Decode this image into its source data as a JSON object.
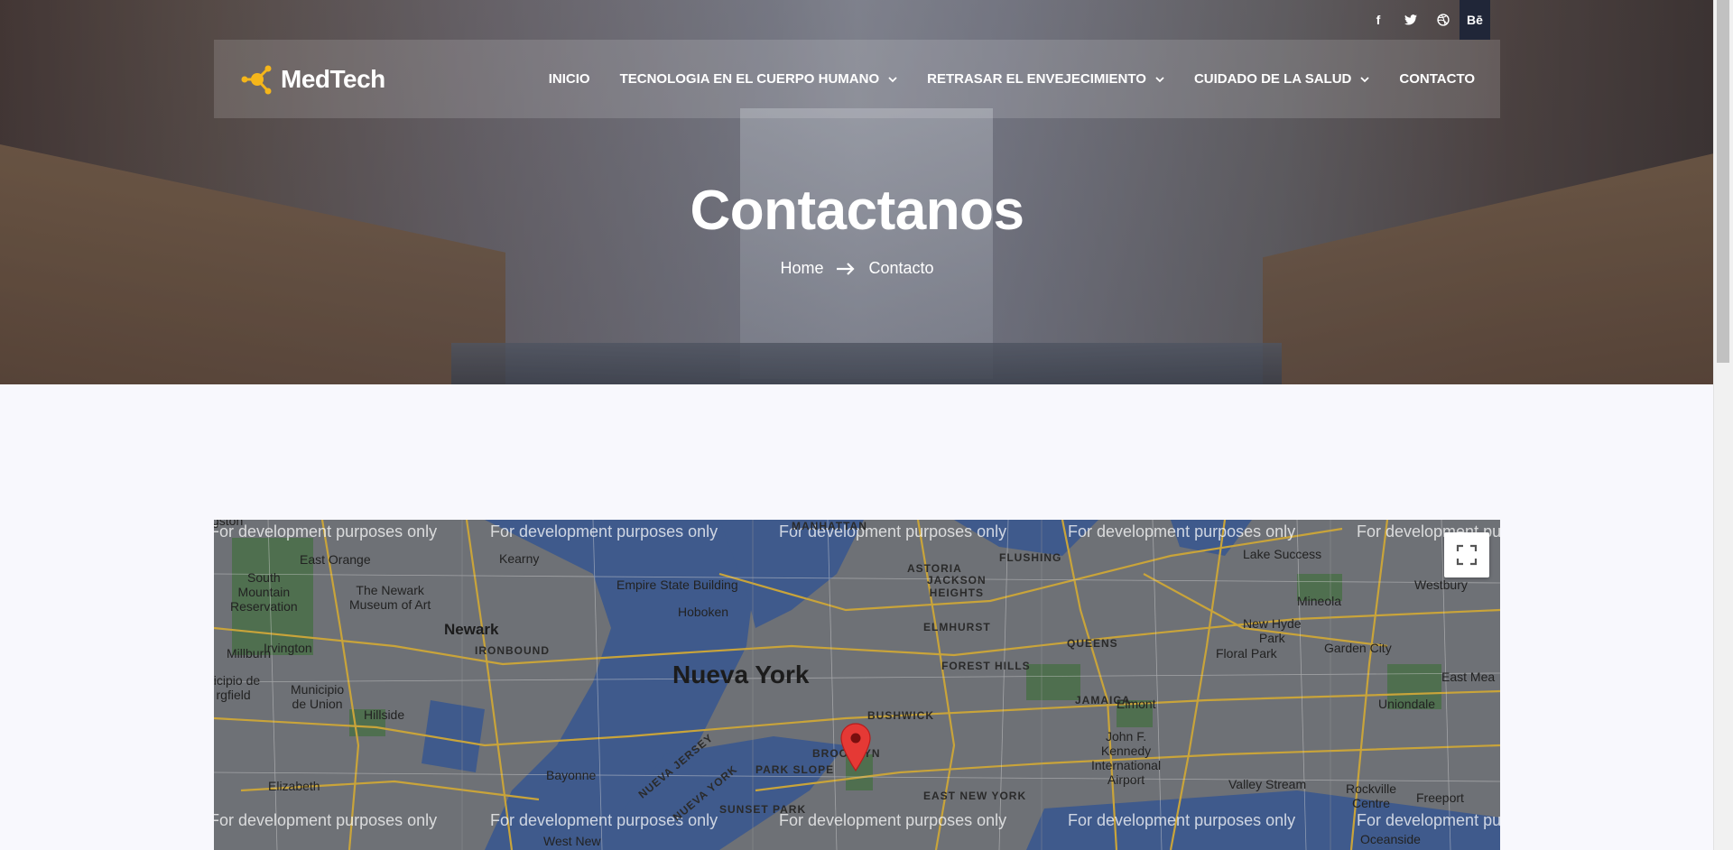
{
  "brand": {
    "name": "MedTech",
    "accent": "#f5b61a"
  },
  "social": [
    {
      "icon": "facebook-icon",
      "glyph": "f"
    },
    {
      "icon": "twitter-icon",
      "glyph": "🐦"
    },
    {
      "icon": "dribbble-icon",
      "glyph": "⊛"
    },
    {
      "icon": "behance-icon",
      "glyph": "Bē"
    }
  ],
  "nav": {
    "items": [
      {
        "label": "INICIO",
        "has_dropdown": false
      },
      {
        "label": "TECNOLOGIA EN EL CUERPO HUMANO",
        "has_dropdown": true
      },
      {
        "label": "RETRASAR EL ENVEJECIMIENTO",
        "has_dropdown": true
      },
      {
        "label": "CUIDADO DE LA SALUD",
        "has_dropdown": true
      },
      {
        "label": "CONTACTO",
        "has_dropdown": false
      }
    ]
  },
  "hero": {
    "title": "Contactanos",
    "breadcrumb": {
      "home": "Home",
      "current": "Contacto"
    }
  },
  "map": {
    "dev_watermark": "For development purposes only",
    "labels": {
      "nueva_york": "Nueva York",
      "newark": "Newark",
      "queens": "QUEENS",
      "brooklyn": "BROOKLYN",
      "manhattan": "MANHATTAN",
      "astoria": "ASTORIA",
      "flushing": "FLUSHING",
      "jackson_heights": "JACKSON\nHEIGHTS",
      "elmhurst": "ELMHURST",
      "forest_hills": "FOREST HILLS",
      "jamaica": "JAMAICA",
      "bushwick": "BUSHWICK",
      "park_slope": "PARK SLOPE",
      "east_new_york": "EAST NEW YORK",
      "sunset_park": "SUNSET PARK",
      "ironbound": "IRONBOUND",
      "empire_state": "Empire State Building",
      "hoboken": "Hoboken",
      "kearny": "Kearny",
      "east_orange": "East Orange",
      "south_mountain": "South\nMountain\nReservation",
      "newark_museum": "The Newark\nMuseum of Art",
      "irvington": "Irvington",
      "millburn": "Millburn",
      "union": "Municipio\nde Union",
      "springfield": "nicipio de\nrgfield",
      "hillside": "Hillside",
      "elizabeth": "Elizabeth",
      "bayonne": "Bayonne",
      "nueva_jersey": "NUEVA JERSEY",
      "nueva_york_state": "NUEVA YORK",
      "west_new": "West New",
      "lake_success": "Lake Success",
      "westbury": "Westbury",
      "mineola": "Mineola",
      "new_hyde_park": "New Hyde\nPark",
      "floral_park": "Floral Park",
      "garden_city": "Garden City",
      "east_meadow": "East Mea",
      "uniondale": "Uniondale",
      "elmont": "Elmont",
      "jfk": "John F.\nKennedy\nInternational\nAirport",
      "valley_stream": "Valley Stream",
      "rockville": "Rockville\nCentre",
      "freeport": "Freeport",
      "oceanside": "Oceanside",
      "livingston": "gston",
      "westbury_top": "Westbury",
      "garden_top": "Ga"
    }
  },
  "colors": {
    "page_bg": "#f8f8fd",
    "dark": "#202638",
    "pin": "#e53935"
  }
}
